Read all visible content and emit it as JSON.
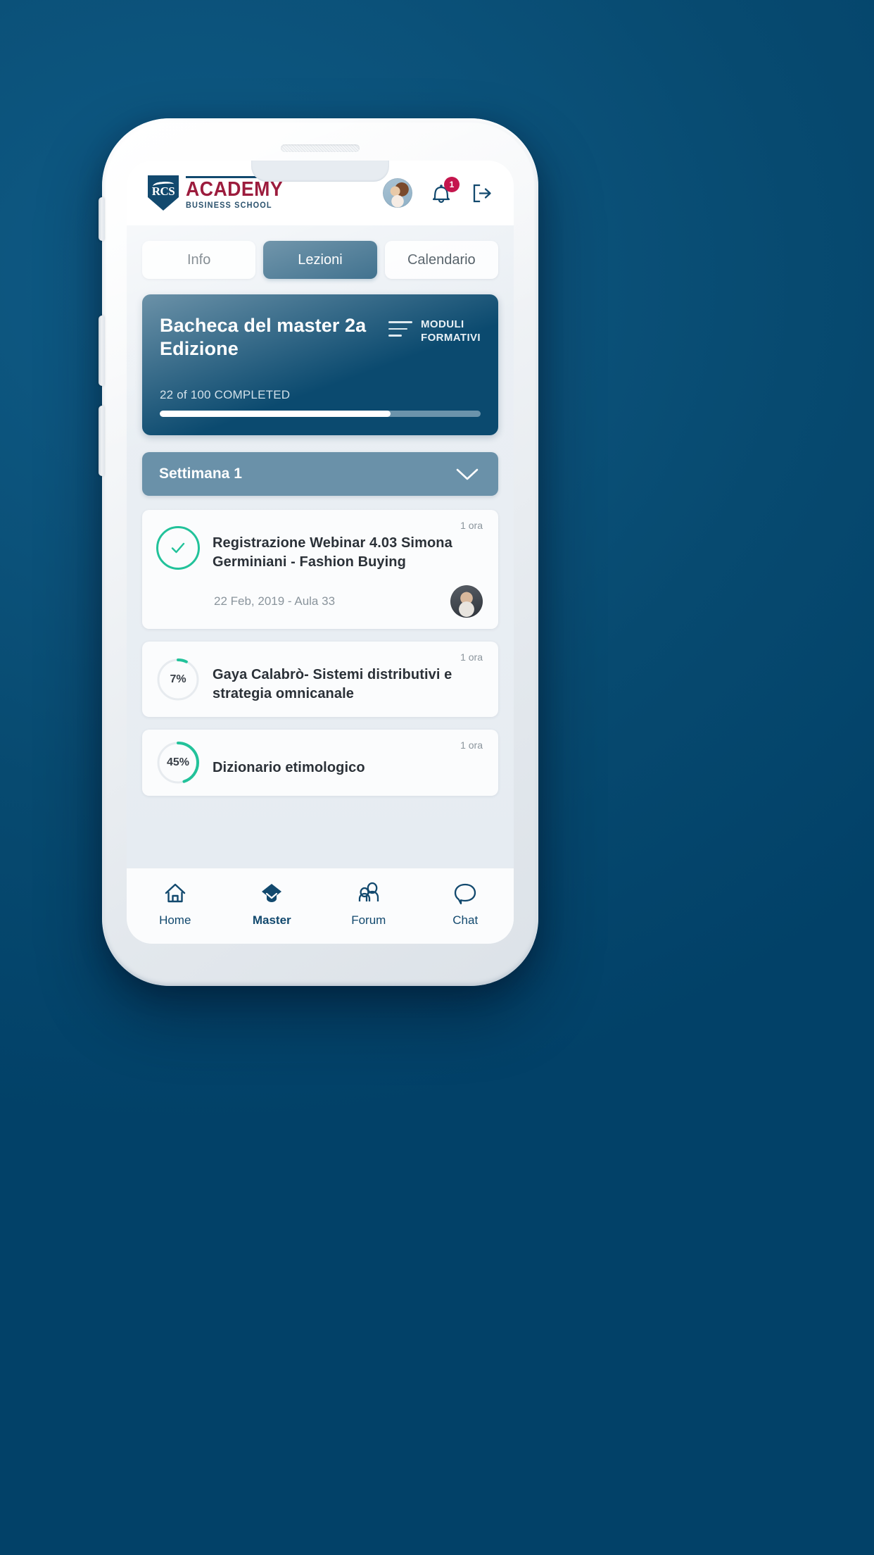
{
  "app": {
    "logo": {
      "shield_text": "RCS",
      "academy": "ACADEMY",
      "school": "BUSINESS SCHOOL"
    },
    "header": {
      "avatar_name": "user-avatar",
      "notification_count": "1",
      "bell_icon": "bell-icon",
      "logout_icon": "logout-icon"
    }
  },
  "tabs": [
    {
      "label": "Info",
      "active": false
    },
    {
      "label": "Lezioni",
      "active": true
    },
    {
      "label": "Calendario",
      "active": false
    }
  ],
  "master_card": {
    "title": "Bacheca del master\n2a Edizione",
    "modules_label": "MODULI\nFORMATIVI",
    "progress_label": "22 of 100 COMPLETED",
    "progress_completed": 22,
    "progress_total": 100,
    "progress_bar_percent": 72,
    "bg_color": "#0b4a6f"
  },
  "week": {
    "label": "Settimana 1",
    "expanded": true,
    "bg_color": "#6a91a9"
  },
  "lessons": [
    {
      "duration": "1 ora",
      "title": "Registrazione Webinar 4.03 Simona Germiniani - Fashion Buying",
      "status": "completed",
      "progress_percent": 100,
      "meta": "22 Feb, 2019 - Aula 33",
      "has_teacher_avatar": true
    },
    {
      "duration": "1 ora",
      "title": "Gaya Calabrò- Sistemi distributivi e strategia omnicanale",
      "status": "in-progress",
      "progress_percent": 7,
      "progress_text": "7%",
      "meta": "",
      "has_teacher_avatar": false
    },
    {
      "duration": "1 ora",
      "title": "Dizionario etimologico",
      "status": "in-progress",
      "progress_percent": 45,
      "progress_text": "45%",
      "meta": "",
      "has_teacher_avatar": false
    }
  ],
  "bottom_nav": [
    {
      "label": "Home",
      "icon": "home-icon",
      "active": false
    },
    {
      "label": "Master",
      "icon": "graduation-cap-icon",
      "active": true
    },
    {
      "label": "Forum",
      "icon": "people-icon",
      "active": false
    },
    {
      "label": "Chat",
      "icon": "chat-bubble-icon",
      "active": false
    }
  ],
  "colors": {
    "brand_navy": "#12496e",
    "brand_red": "#9c1c3d",
    "accent_green": "#22c29a",
    "badge_red": "#c4164d",
    "backdrop_blue": "#0b5179"
  }
}
